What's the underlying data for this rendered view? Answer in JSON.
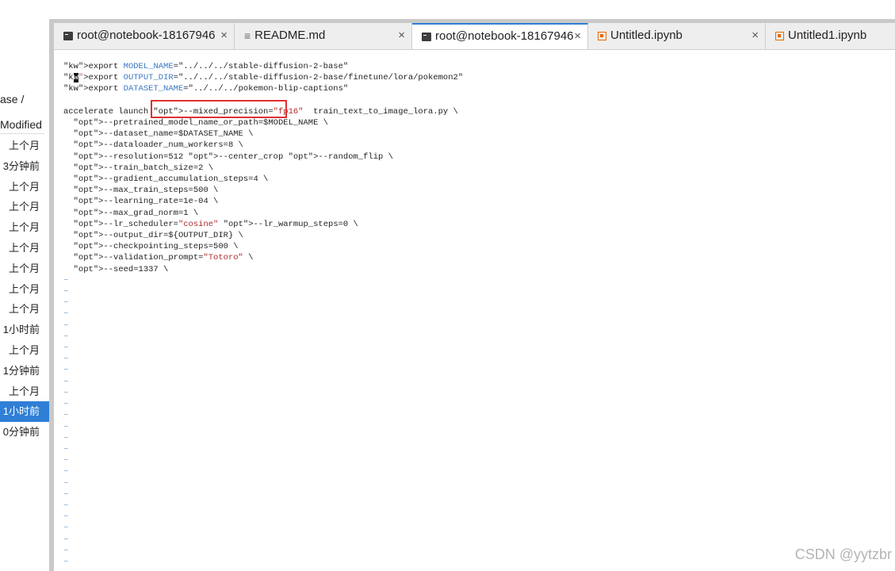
{
  "file_browser": {
    "breadcrumb": "ase /",
    "column_header": "Modified",
    "rows": [
      "上个月",
      "3分钟前",
      "上个月",
      "上个月",
      "上个月",
      "上个月",
      "上个月",
      "上个月",
      "上个月",
      "1小时前",
      "上个月",
      "1分钟前",
      "上个月",
      "1小时前",
      "0分钟前"
    ],
    "selected_index": 13
  },
  "tabs": [
    {
      "label": "root@notebook-18167946",
      "icon": "terminal-icon",
      "close": "×",
      "active": false
    },
    {
      "label": "README.md",
      "icon": "markdown-file-icon",
      "close": "×",
      "active": false
    },
    {
      "label": "root@notebook-18167946",
      "icon": "terminal-icon",
      "close": "×",
      "active": true
    },
    {
      "label": "Untitled.ipynb",
      "icon": "notebook-icon",
      "close": "×",
      "active": false
    },
    {
      "label": "Untitled1.ipynb",
      "icon": "notebook-icon",
      "close": "×",
      "active": false
    }
  ],
  "terminal": {
    "lines": [
      "export MODEL_NAME=\"../../../stable-diffusion-2-base\"",
      "export OUTPUT_DIR=\"../../../stable-diffusion-2-base/finetune/lora/pokemon2\"",
      "export DATASET_NAME=\"../../../pokemon-blip-captions\"",
      "",
      "accelerate launch --mixed_precision=\"fp16\"  train_text_to_image_lora.py \\",
      "  --pretrained_model_name_or_path=$MODEL_NAME \\",
      "  --dataset_name=$DATASET_NAME \\",
      "  --dataloader_num_workers=8 \\",
      "  --resolution=512 --center_crop --random_flip \\",
      "  --train_batch_size=2 \\",
      "  --gradient_accumulation_steps=4 \\",
      "  --max_train_steps=500 \\",
      "  --learning_rate=1e-04 \\",
      "  --max_grad_norm=1 \\",
      "  --lr_scheduler=\"cosine\" --lr_warmup_steps=0 \\",
      "  --output_dir=${OUTPUT_DIR} \\",
      "  --checkpointing_steps=500 \\",
      "  --validation_prompt=\"Totoro\" \\",
      "  --seed=1337 \\"
    ],
    "tilde": "~",
    "tilde_count": 26
  },
  "watermark": "CSDN @yytzbr",
  "colors": {
    "accent": "#2f7fd6",
    "highlight_box": "#e03030"
  }
}
